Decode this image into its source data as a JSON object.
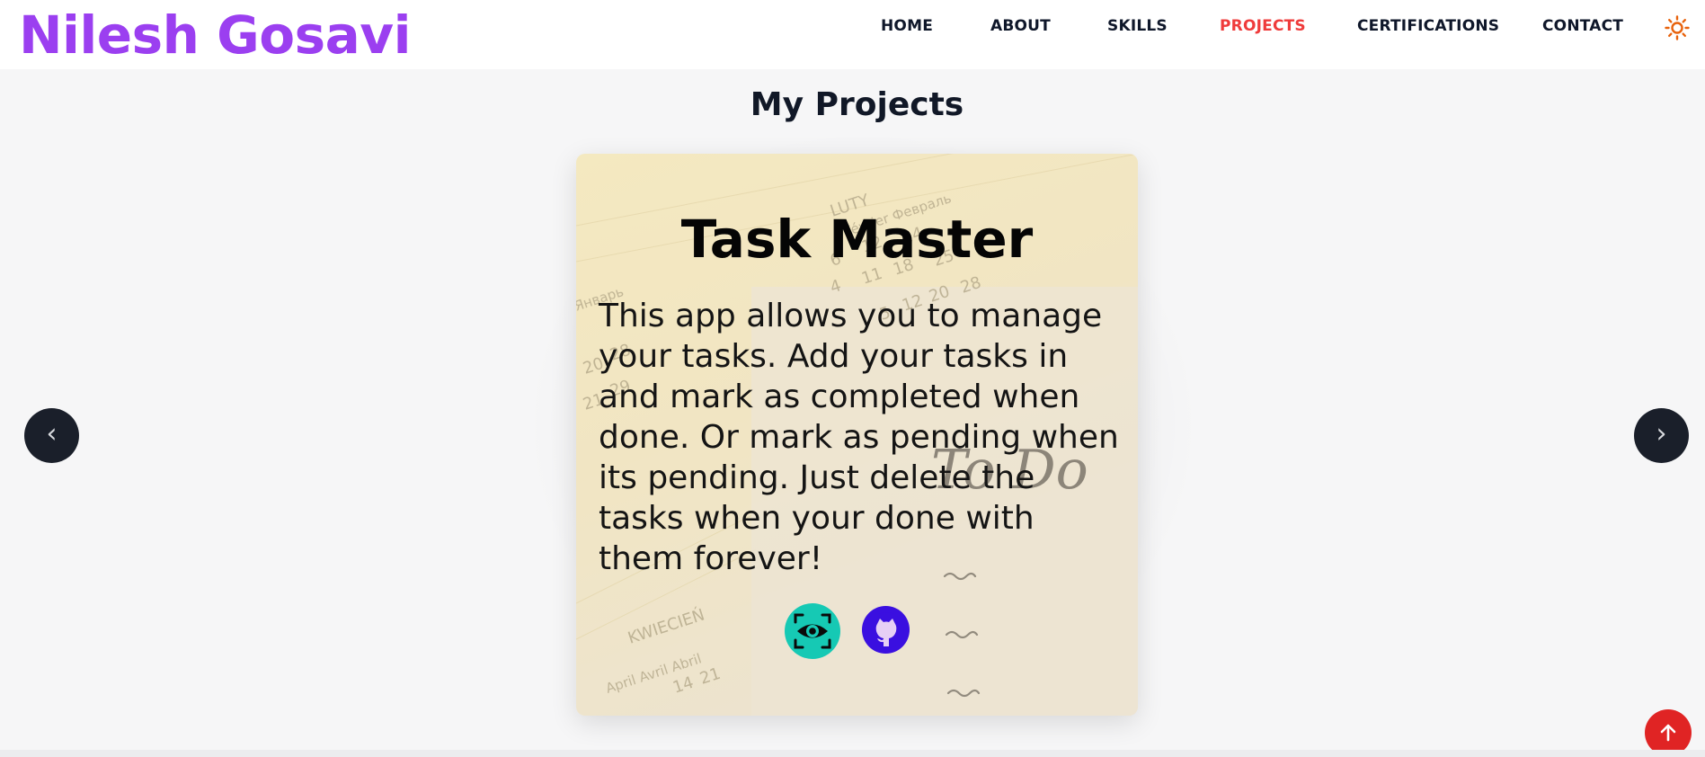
{
  "brand": {
    "name": "Nilesh Gosavi"
  },
  "nav": {
    "items": [
      {
        "label": "HOME",
        "active": false
      },
      {
        "label": "ABOUT",
        "active": false
      },
      {
        "label": "SKILLS",
        "active": false
      },
      {
        "label": "PROJECTS",
        "active": true
      },
      {
        "label": "CERTIFICATIONS",
        "active": false
      },
      {
        "label": "CONTACT",
        "active": false
      }
    ],
    "theme_icon": "sun-icon"
  },
  "section": {
    "title": "My Projects"
  },
  "project": {
    "title": "Task Master",
    "description": "This app allows you to manage your tasks. Add your tasks in and mark as completed when done. Or mark as pending when its pending. Just delete the tasks when your done with them forever!",
    "image_text": {
      "todo": "To Do",
      "month_top": "LUTY",
      "month_row": "Février  Февраль",
      "month_left": "Январь",
      "month_bottom": "KWIECIEŃ",
      "month_bottom_row": "April  Avril  Abril"
    },
    "live_icon": "eye-icon",
    "github_icon": "github-icon"
  },
  "carousel": {
    "prev_label": "‹",
    "next_label": "›"
  },
  "colors": {
    "brand": "#9b3ff0",
    "nav_active": "#ef3b3b",
    "live_button": "#16c9b4",
    "github_button": "#3a0fe0",
    "scroll_top": "#e02424",
    "arrow_bg": "#1a1f2a"
  },
  "scroll_top_icon": "arrow-up-icon"
}
